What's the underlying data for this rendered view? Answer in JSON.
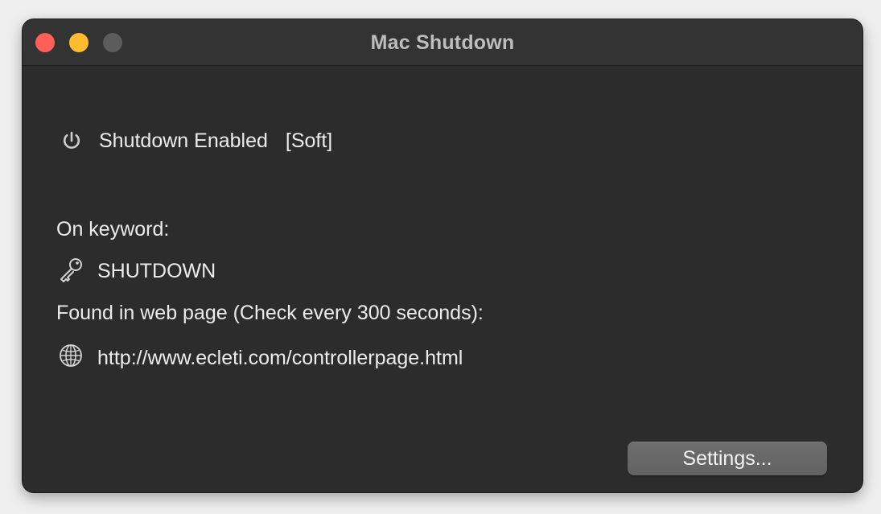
{
  "window": {
    "title": "Mac Shutdown",
    "controls": {
      "close_color": "#ff5f57",
      "minimize_color": "#febc2e",
      "zoom_color": "#5c5c5c"
    }
  },
  "status": {
    "icon": "power-icon",
    "text": "Shutdown Enabled",
    "mode": "[Soft]"
  },
  "keyword": {
    "label": "On keyword:",
    "icon": "key-icon",
    "value": "SHUTDOWN"
  },
  "source": {
    "label": "Found in web page (Check every 300 seconds):",
    "icon": "globe-icon",
    "url": "http://www.ecleti.com/controllerpage.html"
  },
  "actions": {
    "settings_label": "Settings..."
  }
}
